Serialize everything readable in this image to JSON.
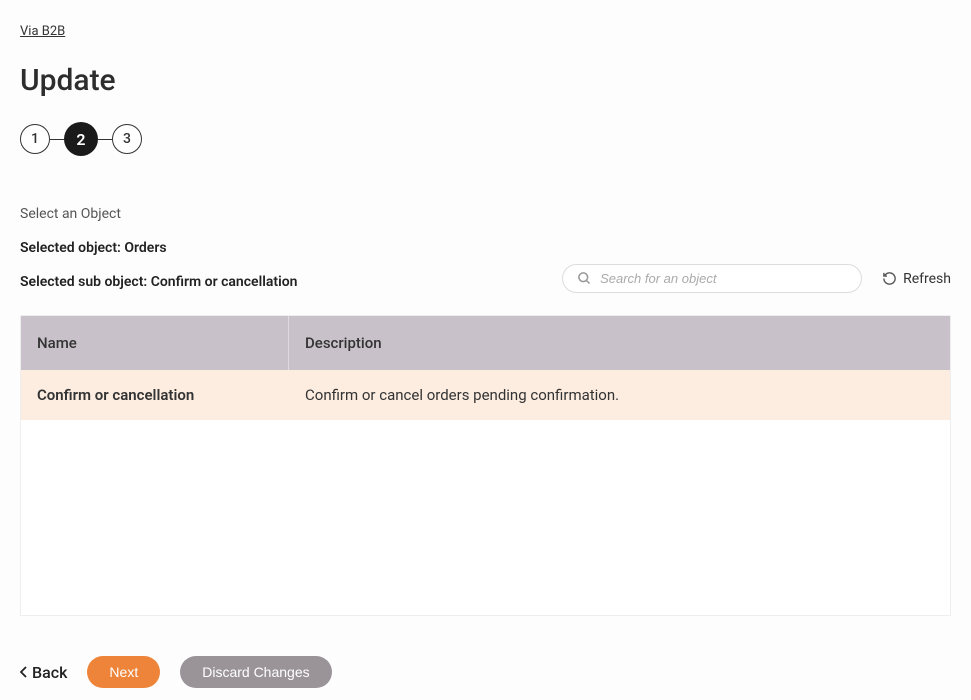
{
  "breadcrumb": {
    "label": "Via B2B"
  },
  "page": {
    "title": "Update"
  },
  "stepper": {
    "steps": [
      {
        "num": "1",
        "active": false
      },
      {
        "num": "2",
        "active": true
      },
      {
        "num": "3",
        "active": false
      }
    ]
  },
  "section": {
    "label": "Select an Object"
  },
  "selected": {
    "object_label": "Selected object: Orders",
    "subobject_label": "Selected sub object: Confirm or cancellation"
  },
  "search": {
    "placeholder": "Search for an object"
  },
  "refresh": {
    "label": "Refresh"
  },
  "table": {
    "headers": {
      "name": "Name",
      "description": "Description"
    },
    "rows": [
      {
        "name": "Confirm or cancellation",
        "description": "Confirm or cancel orders pending confirmation."
      }
    ]
  },
  "footer": {
    "back": "Back",
    "next": "Next",
    "discard": "Discard Changes"
  }
}
